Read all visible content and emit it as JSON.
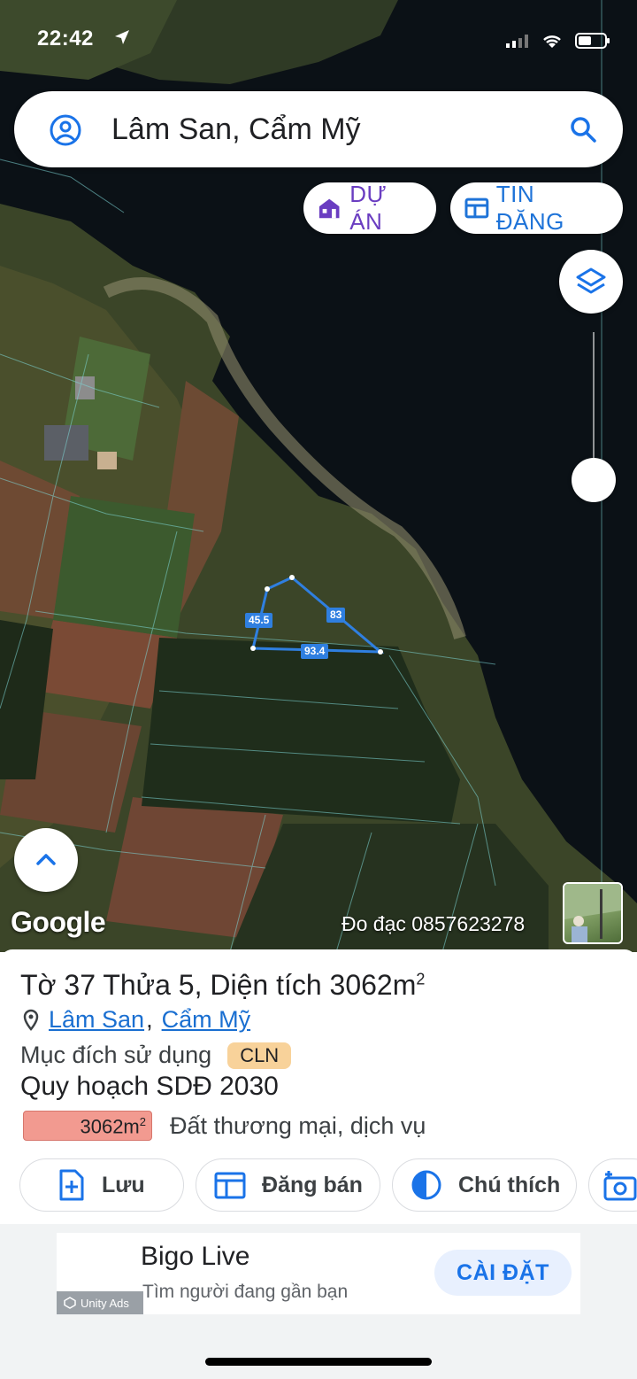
{
  "status_bar": {
    "time": "22:42"
  },
  "search": {
    "query": "Lâm San, Cẩm Mỹ"
  },
  "chips": {
    "du_an": "DỰ ÁN",
    "tin_dang": "TIN ĐĂNG"
  },
  "map": {
    "dimensions": [
      "45.5",
      "83",
      "93.4"
    ],
    "attribution": "Google",
    "watermark": "Đo đạc 0857623278"
  },
  "parcel": {
    "title": "Tờ 37 Thửa 5, Diện tích 3062m",
    "title_sup": "2",
    "location_ward": "Lâm San",
    "location_sep": ",",
    "location_district": "Cẩm Mỹ",
    "purpose_label": "Mục đích sử dụng",
    "purpose_code": "CLN",
    "plan_label": "Quy hoạch SDĐ 2030",
    "plan_area": "3062m",
    "plan_area_sup": "2",
    "plan_use": "Đất thương mại, dịch vụ"
  },
  "actions": {
    "save": "Lưu",
    "sell": "Đăng bán",
    "note": "Chú thích"
  },
  "ad": {
    "title": "Bigo Live",
    "subtitle": "Tìm người đang gần bạn",
    "install": "CÀI ĐẶT",
    "network": "Unity Ads"
  },
  "colors": {
    "water": "#0b1116",
    "parcel_line": "#2f7fe0",
    "duan_chip": "#6a3dc1",
    "tindang_chip": "#1e73d8",
    "cln_badge": "#f8d29a",
    "area_badge": "#f29a90"
  }
}
